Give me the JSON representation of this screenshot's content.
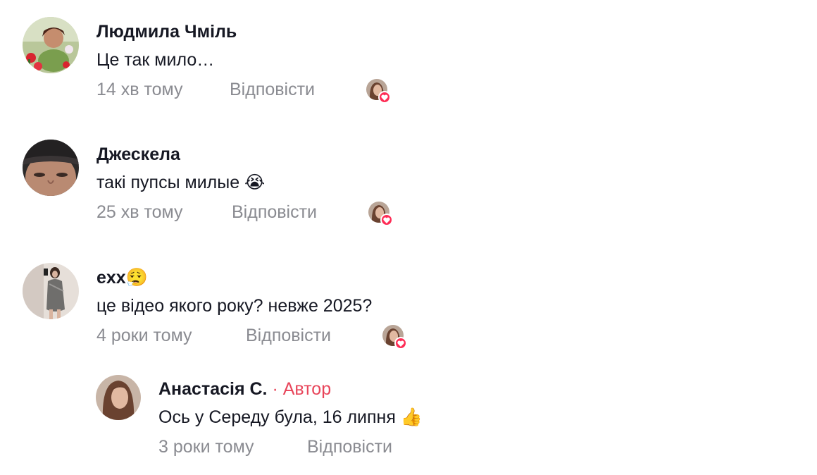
{
  "comments": [
    {
      "author": "Людмила Чміль",
      "text": "Це так мило…",
      "time": "14 хв тому",
      "reply": "Відповісти",
      "avatar_icon": "user-avatar-flowers"
    },
    {
      "author": "Джескела",
      "text": "такі пупсы милые 😭",
      "time": "25 хв тому",
      "reply": "Відповісти",
      "avatar_icon": "user-avatar-face"
    },
    {
      "author": "exx😮‍💨",
      "text": "це відео якого року? невже 2025?",
      "time": "4 роки тому",
      "reply": "Відповісти",
      "avatar_icon": "user-avatar-mirror-selfie"
    }
  ],
  "reply_comment": {
    "author": "Анастасія С.",
    "separator": "·",
    "author_badge": "Автор",
    "text": "Ось у Середу була, 16 липня 👍",
    "time": "3 роки тому",
    "reply": "Відповісти"
  },
  "colors": {
    "author_badge": "#e8455a",
    "meta": "#8a8b91",
    "heart": "#fe2c55"
  }
}
